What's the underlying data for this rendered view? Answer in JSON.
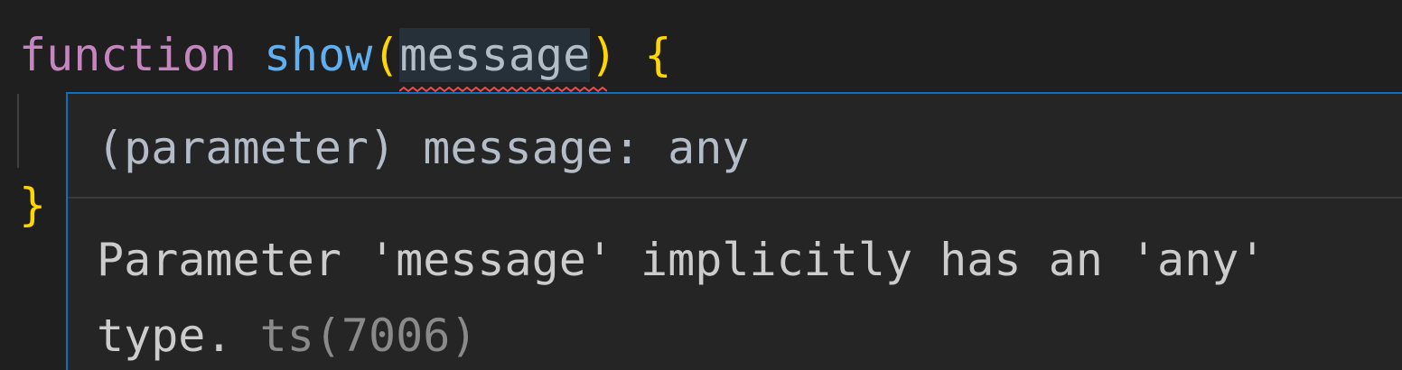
{
  "code": {
    "keyword": "function",
    "function_name": "show",
    "open_paren": "(",
    "param_name": "message",
    "close_paren": ")",
    "open_brace": "{",
    "close_brace": "}"
  },
  "hover": {
    "signature": "(parameter) message: any",
    "message_line1": "Parameter 'message' implicitly has an 'any'",
    "message_line2": "type.",
    "diagnostic_code": "ts(7006)"
  },
  "colors": {
    "keyword": "#c586c0",
    "function": "#61afef",
    "bracket": "#ffd700",
    "error_squiggle": "#f14c4c",
    "hover_border": "#0e6fbd"
  }
}
